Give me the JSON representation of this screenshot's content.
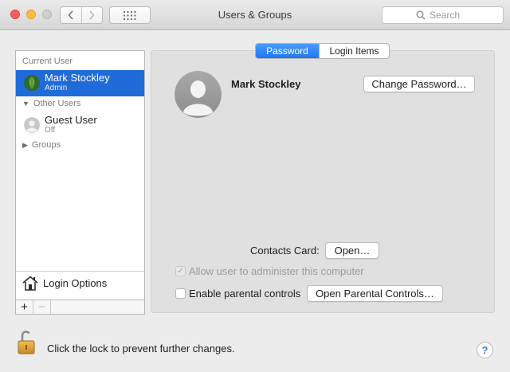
{
  "window": {
    "title": "Users & Groups"
  },
  "toolbar": {
    "back_icon": "chevron-left-icon",
    "forward_icon": "chevron-right-icon",
    "grid_icon": "show-all-grid-icon",
    "search_placeholder": "Search"
  },
  "sidebar": {
    "current_user_header": "Current User",
    "current_user": {
      "name": "Mark Stockley",
      "role": "Admin"
    },
    "other_users_header": "Other Users",
    "other_users": [
      {
        "name": "Guest User",
        "role": "Off"
      }
    ],
    "groups_header": "Groups",
    "login_options_label": "Login Options",
    "add_label": "+",
    "remove_label": "−"
  },
  "tabs": [
    {
      "label": "Password",
      "active": true
    },
    {
      "label": "Login Items",
      "active": false
    }
  ],
  "main": {
    "user_name": "Mark Stockley",
    "change_password_label": "Change Password…",
    "contacts_card_label": "Contacts Card:",
    "open_label": "Open…",
    "allow_admin_label": "Allow user to administer this computer",
    "allow_admin_checked": true,
    "parental_controls_label": "Enable parental controls",
    "parental_controls_checked": false,
    "open_parental_label": "Open Parental Controls…"
  },
  "footer": {
    "lock_text": "Click the lock to prevent further changes.",
    "help_label": "?"
  },
  "colors": {
    "selection": "#1f6bd9",
    "tab_active": "#2a83f5",
    "help": "#3a7be8"
  }
}
